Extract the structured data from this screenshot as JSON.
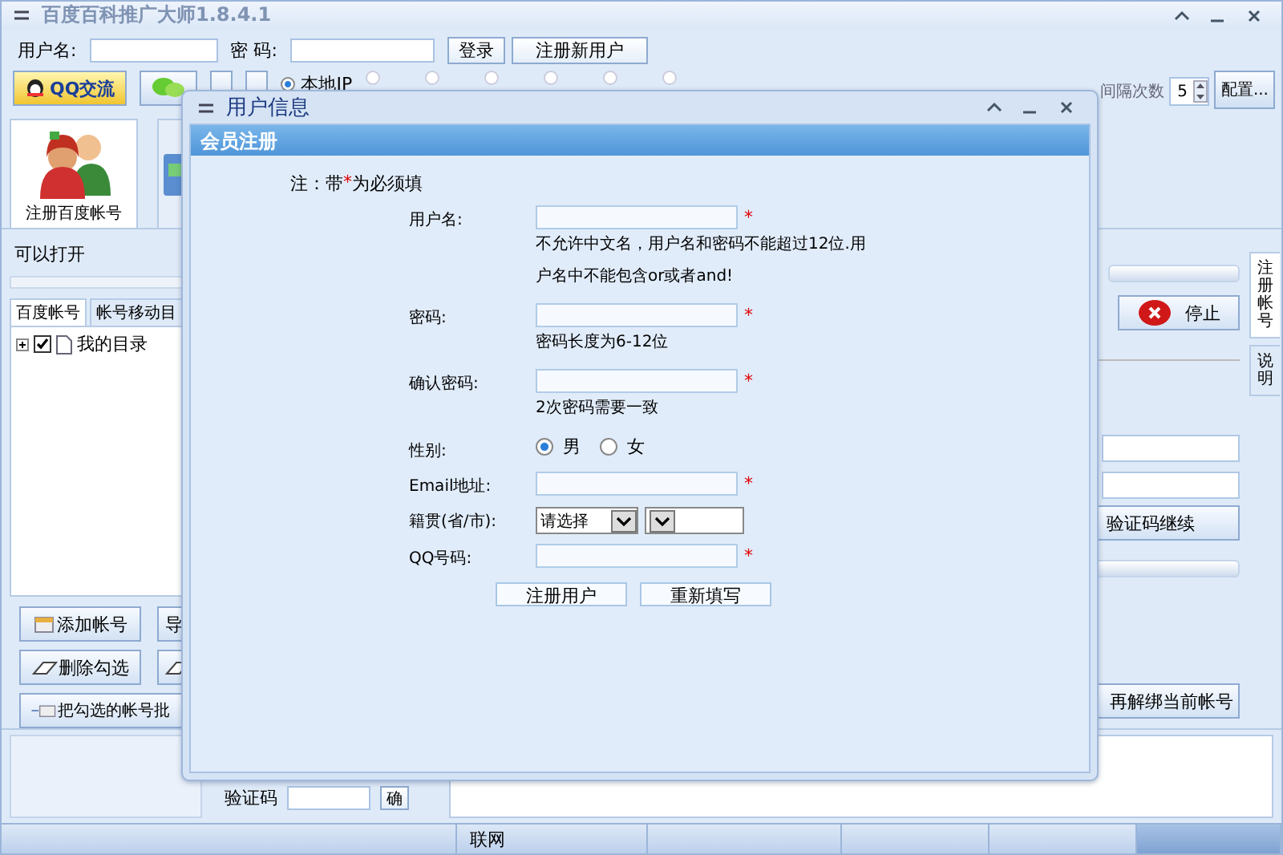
{
  "window": {
    "title": "百度百科推广大师1.8.4.1"
  },
  "login": {
    "username_label": "用户名:",
    "password_label": "密  码:",
    "login_button": "登录",
    "register_button": "注册新用户"
  },
  "toolbar": {
    "buttons": [
      {
        "kind": "qq",
        "label": "QQ交流"
      },
      {
        "kind": "chat"
      },
      {
        "kind": "plain"
      },
      {
        "kind": "plain"
      }
    ],
    "ip_options": [
      {
        "label": "本地IP",
        "selected": true
      }
    ],
    "interval_label": "间隔次数",
    "interval_value": "5",
    "config_button": "配置..."
  },
  "tiles": [
    {
      "kind": "people",
      "label": "注册百度帐号",
      "selected": true
    },
    {
      "kind": "monitor",
      "selected": false
    }
  ],
  "status_text": "可以打开",
  "account_tabs": [
    {
      "label": "百度帐号",
      "selected": true
    },
    {
      "label": "帐号移动目",
      "selected": false
    }
  ],
  "tree": [
    {
      "label": "我的目录",
      "checked": true,
      "expanded": false
    }
  ],
  "left_buttons": [
    [
      {
        "kind": "add",
        "label": "添加帐号"
      },
      {
        "kind": "plain",
        "label": "导"
      }
    ],
    [
      {
        "kind": "erase",
        "label": "删除勾选"
      },
      {
        "kind": "erase"
      }
    ],
    [
      {
        "kind": "move",
        "label": "把勾选的帐号批"
      }
    ]
  ],
  "right": {
    "stop_button": "停止",
    "captcha_continue_button": "验证码继续",
    "unbind_button": "再解绑当前帐号",
    "side_tabs": [
      {
        "label": "注册帐号",
        "selected": true
      },
      {
        "label": "说明",
        "selected": false
      }
    ]
  },
  "captcha": {
    "label": "验证码",
    "confirm_button": "确"
  },
  "status_bar": {
    "cells": [
      "联网"
    ]
  },
  "dialog": {
    "title": "用户信息",
    "header": "会员注册",
    "note_prefix": "注：带",
    "required_mark": "*",
    "note_suffix": "为必须填",
    "fields": [
      {
        "kind": "text",
        "label": "用户名:",
        "required": true,
        "hints": [
          "不允许中文名，用户名和密码不能超过12位.用",
          "户名中不能包含or或者and!"
        ]
      },
      {
        "kind": "text",
        "label": "密码:",
        "required": true,
        "hints": [
          "密码长度为6-12位"
        ]
      },
      {
        "kind": "text",
        "label": "确认密码:",
        "required": true,
        "hints": [
          "2次密码需要一致"
        ]
      },
      {
        "kind": "radio",
        "label": "性别:",
        "options": [
          {
            "label": "男",
            "selected": true
          },
          {
            "label": "女",
            "selected": false
          }
        ]
      },
      {
        "kind": "text",
        "label": "Email地址:",
        "required": true
      },
      {
        "kind": "select",
        "label": "籍贯(省/市):",
        "select_value": "请选择"
      },
      {
        "kind": "text",
        "label": "QQ号码:",
        "required": true
      }
    ],
    "buttons": [
      "注册用户",
      "重新填写"
    ]
  }
}
